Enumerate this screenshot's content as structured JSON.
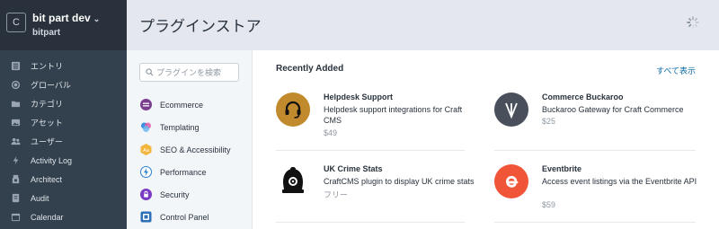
{
  "site": {
    "logo_letter": "C",
    "name": "bit part dev",
    "handle": "bitpart"
  },
  "nav": [
    {
      "label": "エントリ",
      "icon": "entries-icon"
    },
    {
      "label": "グローバル",
      "icon": "globe-icon"
    },
    {
      "label": "カテゴリ",
      "icon": "folder-icon"
    },
    {
      "label": "アセット",
      "icon": "image-icon"
    },
    {
      "label": "ユーザー",
      "icon": "users-icon"
    },
    {
      "label": "Activity Log",
      "icon": "bolt-icon"
    },
    {
      "label": "Architect",
      "icon": "architect-icon"
    },
    {
      "label": "Audit",
      "icon": "audit-icon"
    },
    {
      "label": "Calendar",
      "icon": "calendar-icon"
    }
  ],
  "header": {
    "title": "プラグインストア"
  },
  "search": {
    "placeholder": "プラグインを検索",
    "value": ""
  },
  "categories": [
    {
      "label": "Ecommerce",
      "icon": "ecommerce-icon",
      "color": "#7a3e8f"
    },
    {
      "label": "Templating",
      "icon": "templating-icon",
      "color": "#3d8fe0"
    },
    {
      "label": "SEO & Accessibility",
      "icon": "seo-icon",
      "color": "#f2b63c"
    },
    {
      "label": "Performance",
      "icon": "performance-icon",
      "color": "#2a7fd4"
    },
    {
      "label": "Security",
      "icon": "security-icon",
      "color": "#7a3bc4"
    },
    {
      "label": "Control Panel",
      "icon": "control-panel-icon",
      "color": "#2d6fb8"
    }
  ],
  "recently_added": {
    "title": "Recently Added",
    "see_all": "すべて表示",
    "plugins": [
      {
        "name": "Helpdesk Support",
        "description": "Helpdesk support integrations for Craft CMS",
        "price": "$49",
        "icon": "headset-icon",
        "color": "#c18a2c"
      },
      {
        "name": "Commerce Buckaroo",
        "description": "Buckaroo Gateway for Craft Commerce",
        "price": "$25",
        "icon": "buckaroo-icon",
        "color": "#4a4f5c"
      },
      {
        "name": "UK Crime Stats",
        "description": "CraftCMS plugin to display UK crime stats",
        "price": "フリー",
        "icon": "police-helmet-icon",
        "color": "#ffffff"
      },
      {
        "name": "Eventbrite",
        "description": "Access event listings via the Eventbrite API",
        "price": "$59",
        "icon": "eventbrite-icon",
        "color": "#f05537"
      }
    ]
  }
}
